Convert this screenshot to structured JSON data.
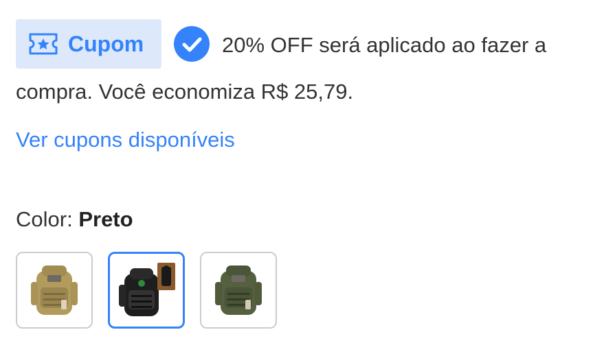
{
  "coupon": {
    "badge_label": "Cupom",
    "badge_icon": "ticket-star-icon",
    "status_icon": "check-circle-icon",
    "line1": "20% OFF será aplicado ao fazer a",
    "line2": "compra. Você economiza R$ 25,79.",
    "accent": "#3483fa",
    "badge_bg": "#dde9fb"
  },
  "coupons_link": {
    "label": "Ver cupons disponíveis"
  },
  "color_selector": {
    "label": "Color:",
    "selected_value": "Preto",
    "options": [
      {
        "name": "khaki",
        "selected": false
      },
      {
        "name": "black",
        "selected": true
      },
      {
        "name": "green",
        "selected": false
      }
    ]
  }
}
